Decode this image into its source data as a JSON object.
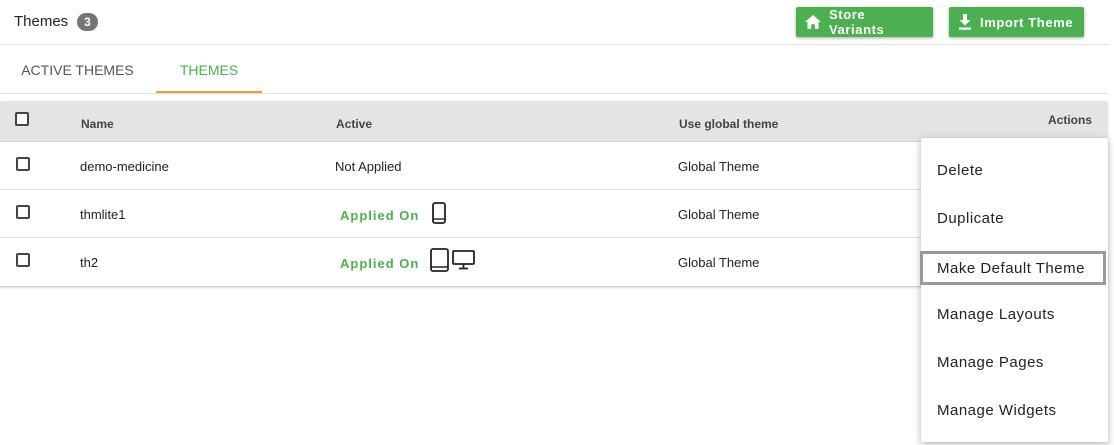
{
  "header": {
    "title": "Themes",
    "count": "3",
    "store_variants_label": "Store Variants",
    "import_theme_label": "Import Theme"
  },
  "tabs": [
    {
      "label": "ACTIVE THEMES",
      "active": false
    },
    {
      "label": "THEMES",
      "active": true
    }
  ],
  "table": {
    "columns": [
      "Name",
      "Active",
      "Use global theme",
      "Actions"
    ],
    "rows": [
      {
        "name": "demo-medicine",
        "active": "Not Applied",
        "devices": [],
        "global": "Global Theme"
      },
      {
        "name": "thmlite1",
        "active": "Applied On",
        "devices": [
          "mobile-icon"
        ],
        "global": "Global Theme"
      },
      {
        "name": "th2",
        "active": "Applied On",
        "devices": [
          "tablet-icon",
          "desktop-icon"
        ],
        "global": "Global Theme"
      }
    ]
  },
  "actions_menu": {
    "items": [
      "Delete",
      "Duplicate",
      "Make Default Theme",
      "Manage Layouts",
      "Manage Pages",
      "Manage Widgets"
    ],
    "focused": "Make Default Theme"
  },
  "colors": {
    "accent": "#4caf50",
    "tab_underline": "#f0a030",
    "badge": "#757575",
    "table_header_bg": "#e4e4e4"
  }
}
